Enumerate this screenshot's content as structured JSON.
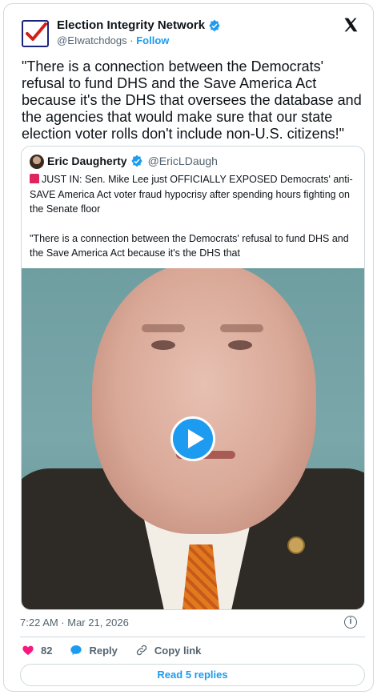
{
  "author": {
    "name": "Election Integrity Network",
    "handle": "@EIwatchdogs",
    "separator": "·",
    "follow_label": "Follow",
    "verified_color": "#1d9bf0"
  },
  "tweet": {
    "text": "\"There is a connection between the Democrats' refusal to fund DHS and the Save America Act because it's the DHS that oversees the database and the agencies that would make sure that our state election voter rolls don't include non-U.S. citizens!\"",
    "timestamp": "7:22 AM · Mar 21, 2026"
  },
  "quote": {
    "name": "Eric Daugherty",
    "handle": "@EricLDaugh",
    "paragraph1": "JUST IN: Sen. Mike Lee just OFFICIALLY EXPOSED Democrats' anti-SAVE America Act voter fraud hypocrisy after spending hours fighting on the Senate floor",
    "paragraph2": "\"There is a connection between the Democrats' refusal to fund DHS and the Save America Act because it's the DHS that"
  },
  "actions": {
    "like_count": "82",
    "reply_label": "Reply",
    "copy_label": "Copy link",
    "read_replies_label": "Read 5 replies"
  },
  "icons": {
    "logo": "checkbox-logo-icon",
    "x": "x-logo-icon",
    "verified": "verified-badge-icon",
    "play": "play-icon",
    "info": "info-icon",
    "like": "heart-icon",
    "reply": "reply-bubble-icon",
    "copy": "link-icon"
  },
  "colors": {
    "accent": "#1d9bf0",
    "like": "#f91880",
    "text": "#0f1419",
    "muted": "#536471"
  }
}
